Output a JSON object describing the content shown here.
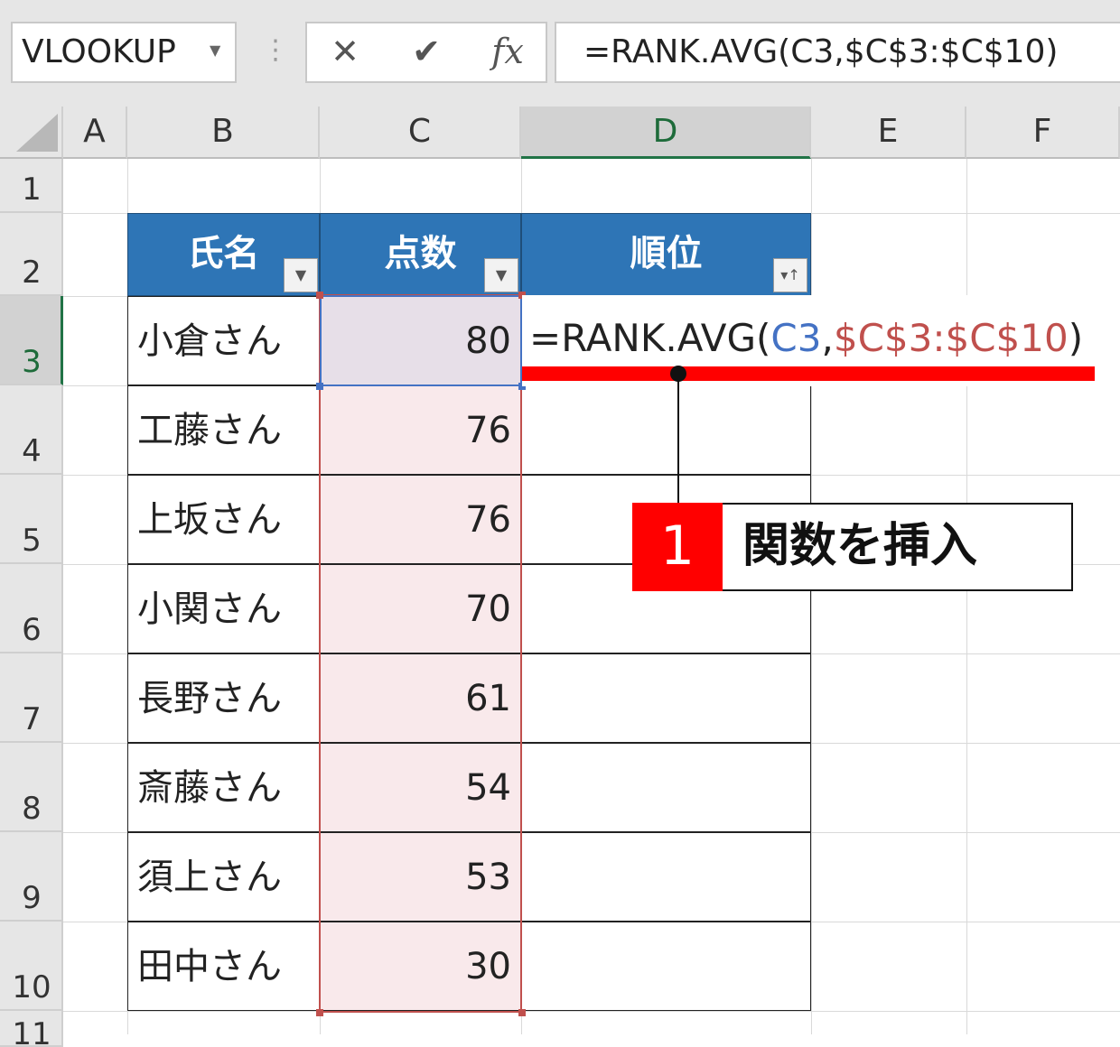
{
  "name_box": {
    "value": "VLOOKUP",
    "dropdown_icon": "chevron-down-icon"
  },
  "formula_buttons": {
    "cancel": "✕",
    "enter": "✔",
    "fx": "fx"
  },
  "formula_bar": {
    "text": "=RANK.AVG(C3,$C$3:$C$10)"
  },
  "columns": [
    "A",
    "B",
    "C",
    "D",
    "E",
    "F"
  ],
  "selected_column": "D",
  "rows": [
    "1",
    "2",
    "3",
    "4",
    "5",
    "6",
    "7",
    "8",
    "9",
    "10",
    "11"
  ],
  "selected_row": "3",
  "table": {
    "headers": [
      "氏名",
      "点数",
      "順位"
    ],
    "names": [
      "小倉さん",
      "工藤さん",
      "上坂さん",
      "小関さん",
      "長野さん",
      "斎藤さん",
      "須上さん",
      "田中さん"
    ],
    "scores": [
      "80",
      "76",
      "76",
      "70",
      "61",
      "54",
      "53",
      "30"
    ],
    "header_color": "#2e75b6"
  },
  "editing_cell": {
    "prefix": "=RANK.AVG(",
    "ref1": "C3",
    "comma": ",",
    "ref2": "$C$3:$C$10",
    "suffix": ")",
    "ref1_color": "#4472c4",
    "ref2_color": "#c0504d"
  },
  "callout": {
    "number": "1",
    "text": "関数を挿入",
    "accent": "#ff0000"
  }
}
